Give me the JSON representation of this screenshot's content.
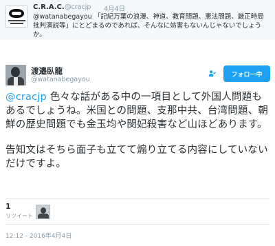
{
  "parent_tweet": {
    "name": "C.R.A.C.",
    "handle": "@cracjp",
    "time": "4月4日",
    "mention": "@watanabegayou",
    "text": "「記紀万葉の浪漫、神道、教育問題、憲法問題、厳正時局批判演説等」にとどまるのであれば、そんなに妨害もないんじゃないでしょうか。"
  },
  "main_tweet": {
    "name": "渡邉臥龍",
    "handle": "@watanabegayou",
    "follow_label": "フォロー中",
    "mention": "@cracjp",
    "paragraph1": " 色々な話がある中の一項目として外国人問題もあるでしょうね。米国との問題、支那中共、台湾問題、朝鮮の歴史問題でも金玉均や閔妃殺害など山ほどあります。",
    "paragraph2": "告知文はそちら面子も立てて煽り立てる内容にしていないだけですよ。",
    "retweet_count": "1",
    "retweet_label": "リツイート",
    "timestamp": "12:12 - 2016年4月4日"
  },
  "colors": {
    "accent": "#1da1f2",
    "secondary_text": "#8899a6",
    "parent_background": "#f5f8fa"
  },
  "icons": {
    "follow": "person-check-icon"
  }
}
